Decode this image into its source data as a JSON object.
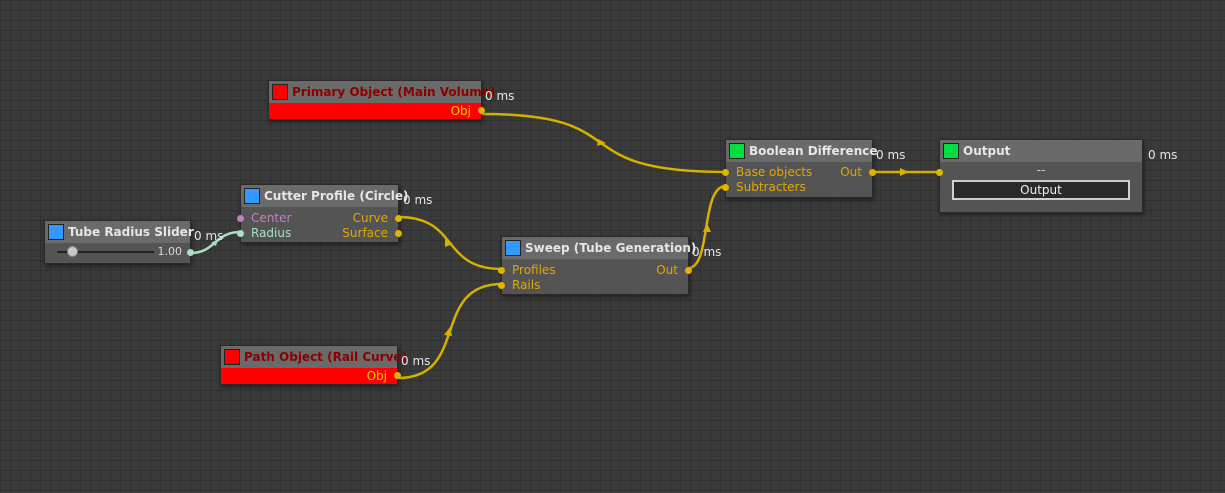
{
  "colors": {
    "background": "#3a3a3a",
    "wire": "#d4b000",
    "port": "#e0b400",
    "slider_wire": "#a8e0c0",
    "swatch_red": "#ff0000",
    "swatch_blue": "#3399ff",
    "swatch_green": "#00e040",
    "center_port": "#c080c0"
  },
  "nodes": {
    "primary_object": {
      "title": "Primary Object (Main Volume)",
      "time": "0 ms",
      "out_label": "Obj",
      "swatch": "#ff0000"
    },
    "boolean_difference": {
      "title": "Boolean Difference",
      "time": "0 ms",
      "inputs": [
        "Base objects",
        "Subtracters"
      ],
      "output": "Out",
      "swatch": "#00e040"
    },
    "output": {
      "title": "Output",
      "time": "0 ms",
      "value": "--",
      "button_label": "Output",
      "swatch": "#00e040"
    },
    "cutter_profile": {
      "title": "Cutter Profile (Circle)",
      "time": "0 ms",
      "inputs": [
        "Center",
        "Radius"
      ],
      "outputs": [
        "Curve",
        "Surface"
      ],
      "swatch": "#3399ff"
    },
    "tube_radius_slider": {
      "title": "Tube Radius Slider",
      "time": "0 ms",
      "value": "1.00",
      "swatch": "#3399ff"
    },
    "sweep": {
      "title": "Sweep (Tube Generation)",
      "time": "0 ms",
      "inputs": [
        "Profiles",
        "Rails"
      ],
      "output": "Out",
      "swatch": "#3399ff"
    },
    "path_object": {
      "title": "Path Object (Rail Curve)",
      "time": "0 ms",
      "out_label": "Obj",
      "swatch": "#ff0000"
    }
  }
}
